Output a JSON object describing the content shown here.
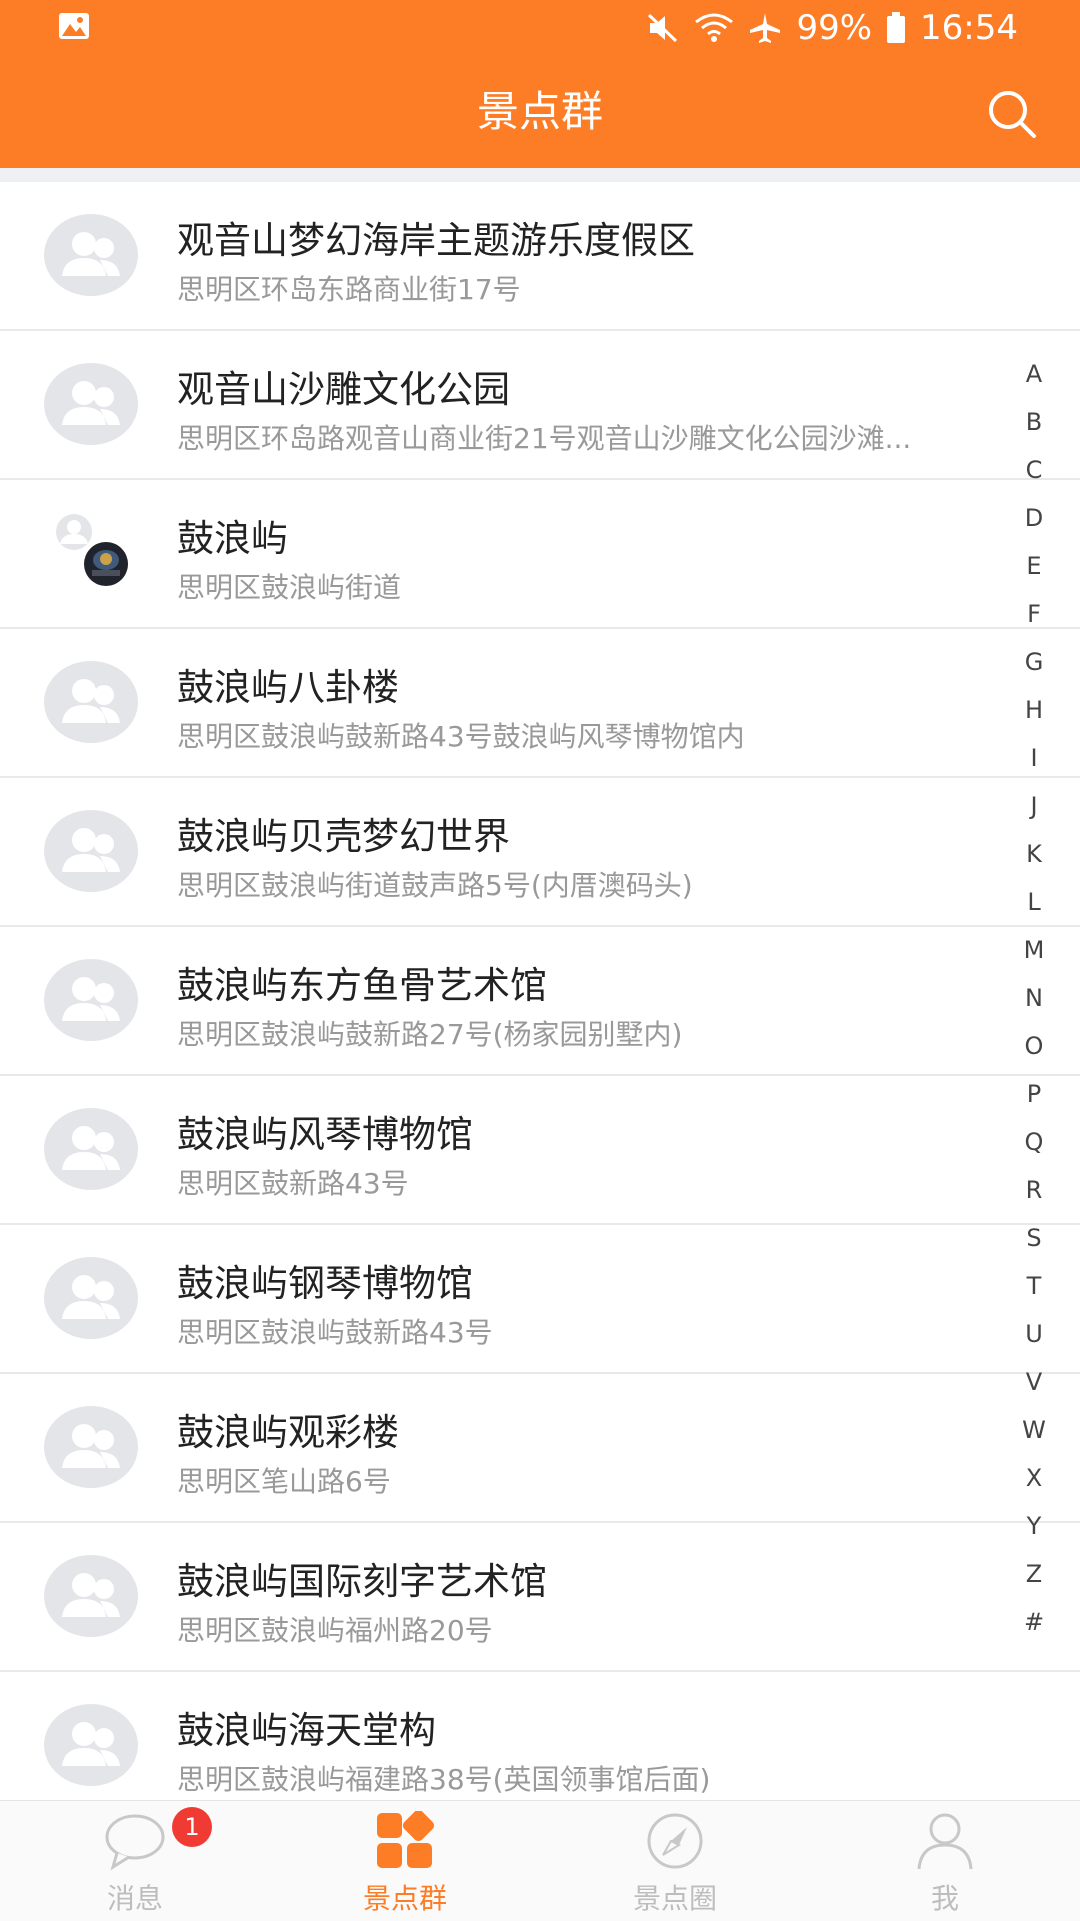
{
  "status_bar": {
    "battery": "99%",
    "time": "16:54",
    "icons": [
      "gallery-icon",
      "mute-icon",
      "wifi-icon",
      "airplane-icon",
      "battery-icon"
    ]
  },
  "header": {
    "title": "景点群",
    "search_icon": "search-icon"
  },
  "list": {
    "items": [
      {
        "name": "观音山梦幻海岸主题游乐度假区",
        "address": "思明区环岛东路商业街17号",
        "avatar": "group-avatar-icon"
      },
      {
        "name": "观音山沙雕文化公园",
        "address": "思明区环岛路观音山商业街21号观音山沙雕文化公园沙滩...",
        "avatar": "group-avatar-icon"
      },
      {
        "name": "鼓浪屿",
        "address": "思明区鼓浪屿街道",
        "avatar": "photo-avatar"
      },
      {
        "name": "鼓浪屿八卦楼",
        "address": "思明区鼓浪屿鼓新路43号鼓浪屿风琴博物馆内",
        "avatar": "group-avatar-icon"
      },
      {
        "name": "鼓浪屿贝壳梦幻世界",
        "address": "思明区鼓浪屿街道鼓声路5号(内厝澳码头)",
        "avatar": "group-avatar-icon"
      },
      {
        "name": "鼓浪屿东方鱼骨艺术馆",
        "address": "思明区鼓浪屿鼓新路27号(杨家园别墅内)",
        "avatar": "group-avatar-icon"
      },
      {
        "name": "鼓浪屿风琴博物馆",
        "address": "思明区鼓新路43号",
        "avatar": "group-avatar-icon"
      },
      {
        "name": "鼓浪屿钢琴博物馆",
        "address": "思明区鼓浪屿鼓新路43号",
        "avatar": "group-avatar-icon"
      },
      {
        "name": "鼓浪屿观彩楼",
        "address": "思明区笔山路6号",
        "avatar": "group-avatar-icon"
      },
      {
        "name": "鼓浪屿国际刻字艺术馆",
        "address": "思明区鼓浪屿福州路20号",
        "avatar": "group-avatar-icon"
      },
      {
        "name": "鼓浪屿海天堂构",
        "address": "思明区鼓浪屿福建路38号(英国领事馆后面)",
        "avatar": "group-avatar-icon"
      }
    ]
  },
  "index_bar": {
    "letters": [
      "A",
      "B",
      "C",
      "D",
      "E",
      "F",
      "G",
      "H",
      "I",
      "J",
      "K",
      "L",
      "M",
      "N",
      "O",
      "P",
      "Q",
      "R",
      "S",
      "T",
      "U",
      "V",
      "W",
      "X",
      "Y",
      "Z",
      "#"
    ]
  },
  "tab_bar": {
    "tabs": [
      {
        "label": "消息",
        "icon": "chat-bubble-icon",
        "badge": "1",
        "active": false
      },
      {
        "label": "景点群",
        "icon": "grid-icon",
        "active": true
      },
      {
        "label": "景点圈",
        "icon": "compass-icon",
        "active": false
      },
      {
        "label": "我",
        "icon": "person-icon",
        "active": false
      }
    ]
  },
  "colors": {
    "accent": "#fd7d26",
    "badge": "#ef3b33",
    "avatar_bg": "#e4e5e9"
  }
}
